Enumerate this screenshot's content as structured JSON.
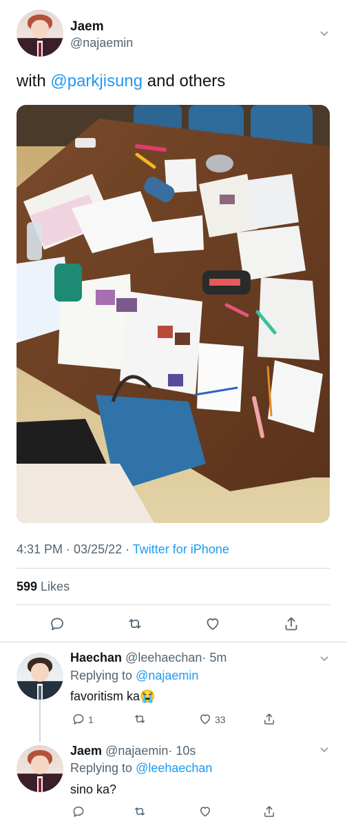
{
  "tweet": {
    "name": "Jaem",
    "handle": "@najaemin",
    "text_prefix": "with ",
    "text_mention": "@parkjisung",
    "text_suffix": " and others",
    "time": "4:31 PM · 03/25/22 · ",
    "source": "Twitter for iPhone",
    "likes_count": "599",
    "likes_label": " Likes"
  },
  "replies": [
    {
      "name": "Haechan",
      "handle": "@leehaechan",
      "time": "· 5m",
      "replying_label": "Replying to ",
      "replying_to": "@najaemin",
      "text": "favoritism ka😭",
      "reply_count": "1",
      "like_count": "33"
    },
    {
      "name": "Jaem",
      "handle": "@najaemin",
      "time": "· 10s",
      "replying_label": "Replying to ",
      "replying_to": "@leehaechan",
      "text": "sino ka?"
    }
  ],
  "icons": {
    "reply": "reply-icon",
    "retweet": "retweet-icon",
    "like": "heart-icon",
    "share": "share-icon",
    "more": "chevron-down-icon"
  },
  "colors": {
    "accent": "#1d9bf0",
    "secondary_text": "#536471",
    "divider": "#cfd9de"
  }
}
